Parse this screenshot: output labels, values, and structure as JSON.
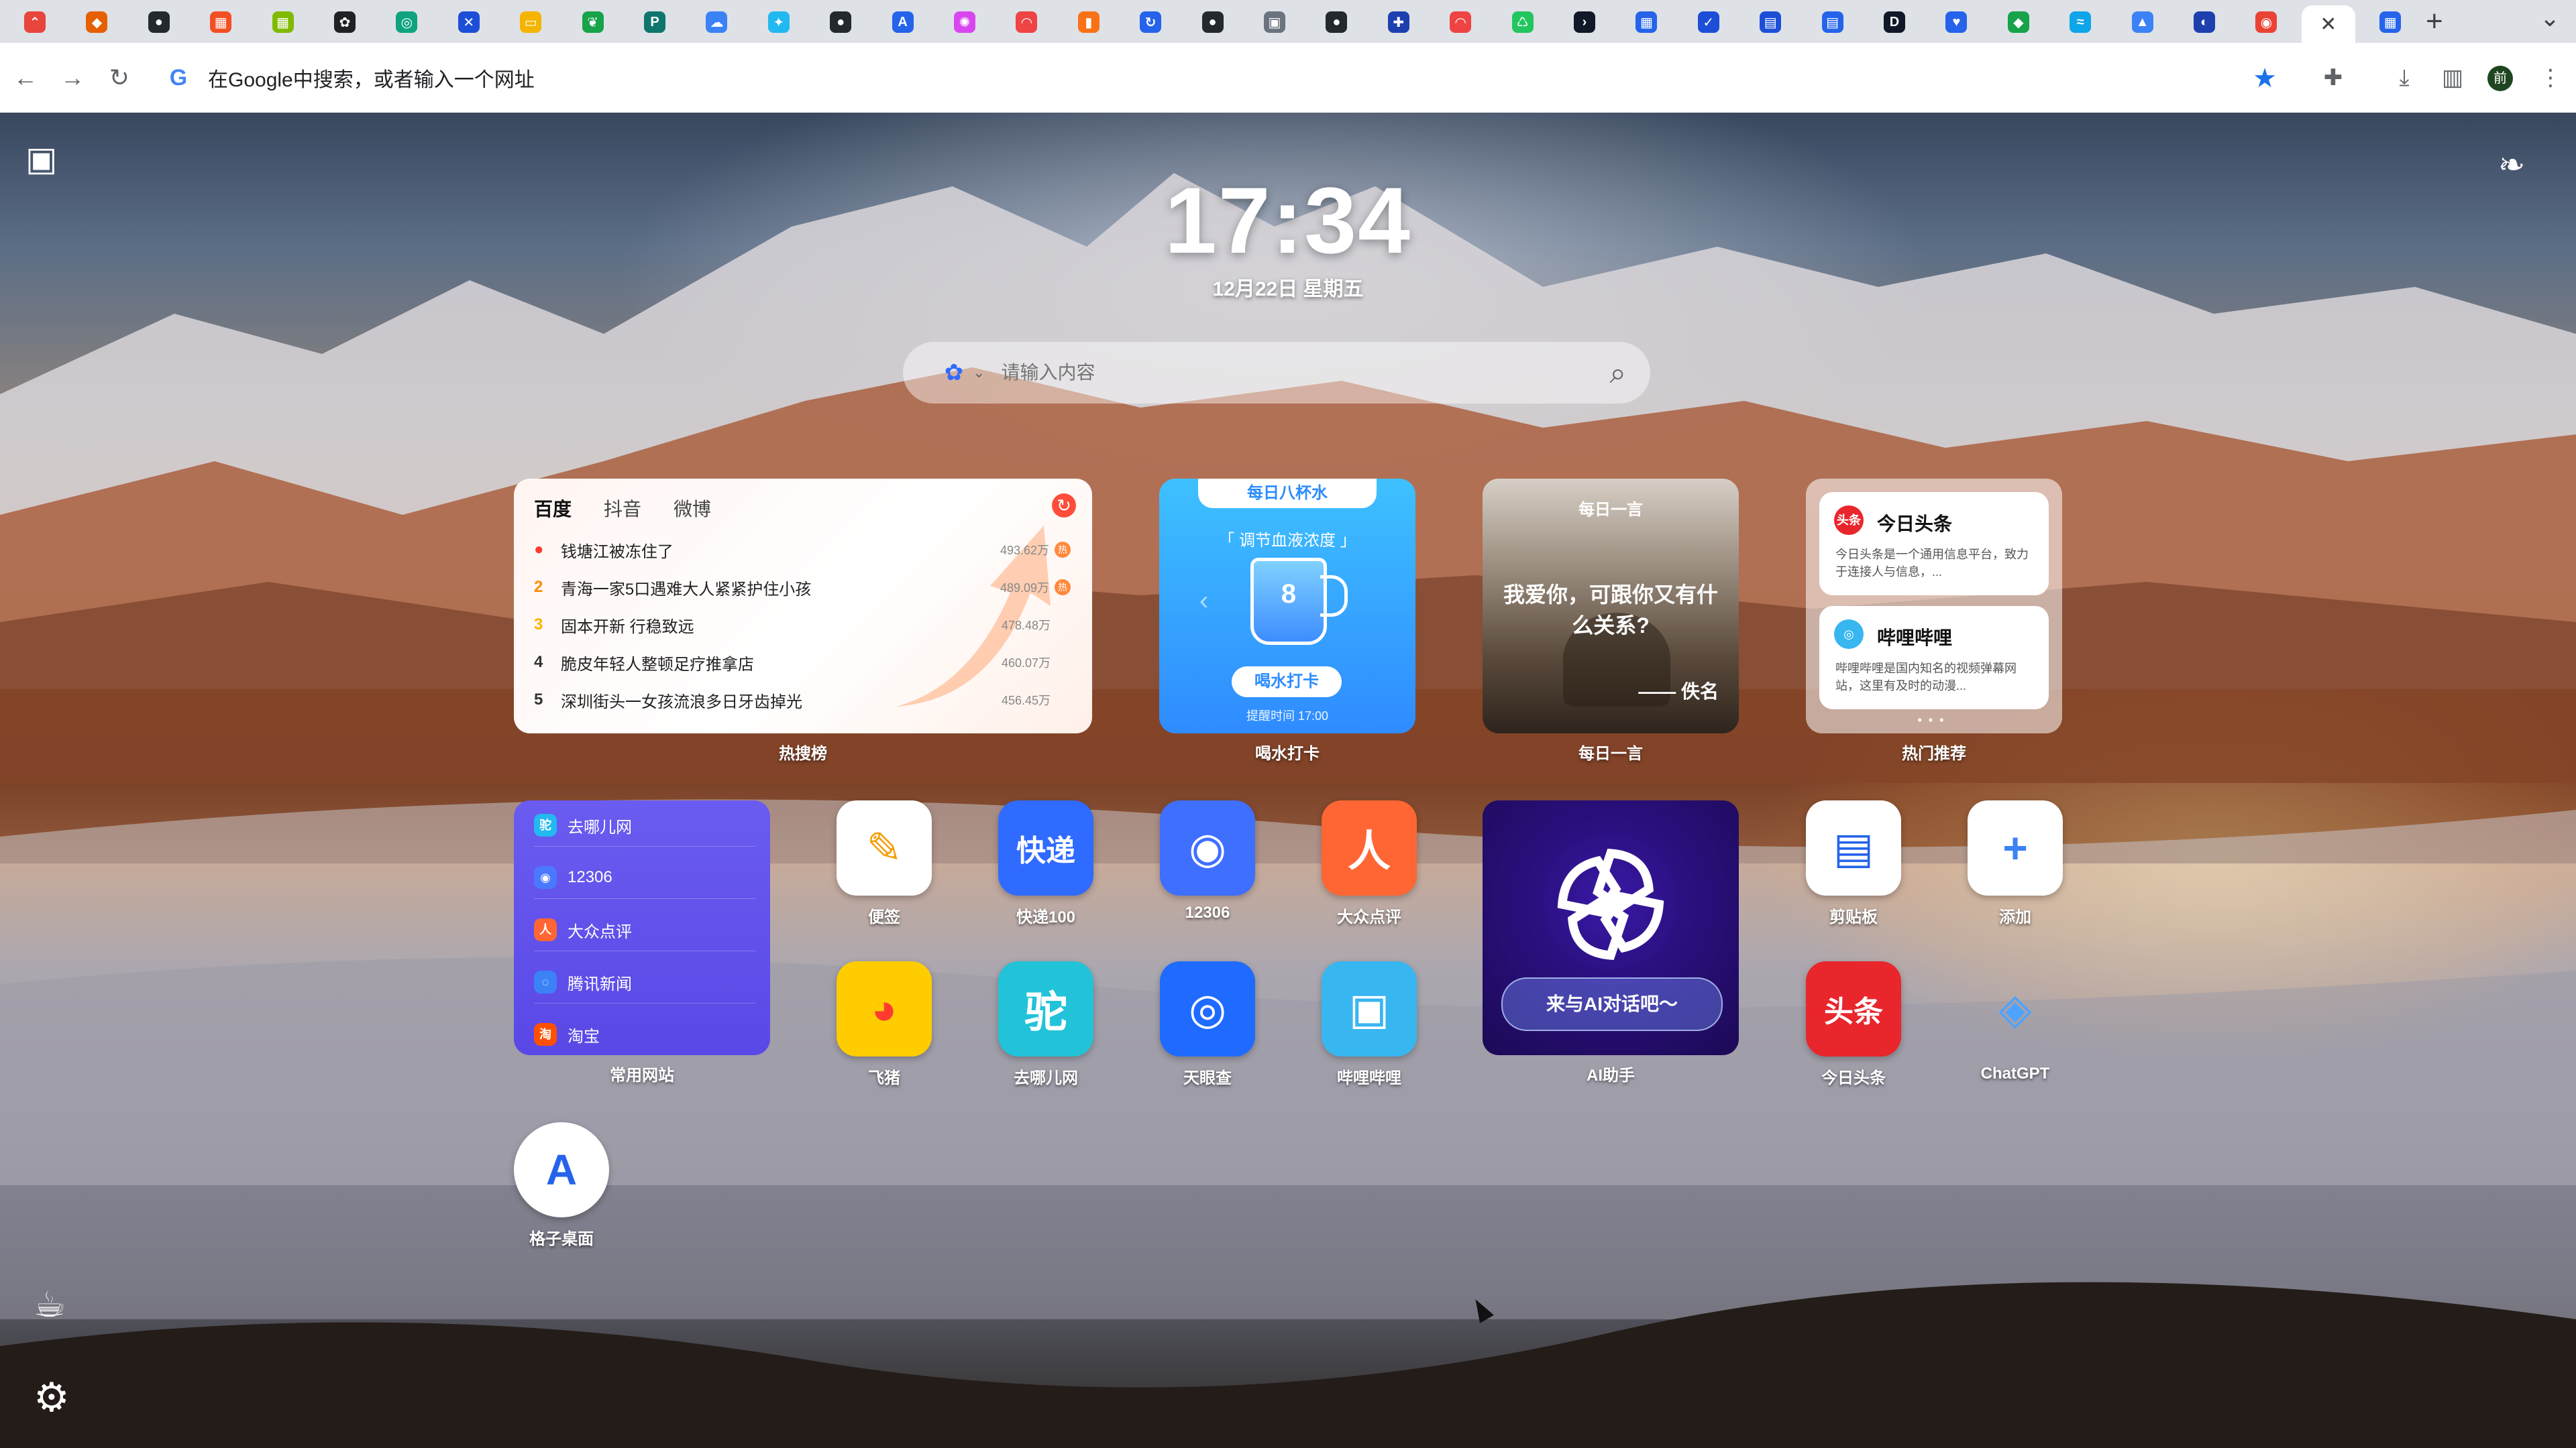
{
  "browser": {
    "tabs": [
      {
        "icon": "cursor-app-icon",
        "color": "#e8453c",
        "glyph": "⌃"
      },
      {
        "icon": "fox-icon",
        "color": "#e66000",
        "glyph": "◆"
      },
      {
        "icon": "github-icon",
        "color": "#24292e",
        "glyph": "●"
      },
      {
        "icon": "microsoft-icon",
        "color": "#f25022",
        "glyph": "▦"
      },
      {
        "icon": "microsoft-icon",
        "color": "#7fba00",
        "glyph": "▦"
      },
      {
        "icon": "openai-icon",
        "color": "#202124",
        "glyph": "✿"
      },
      {
        "icon": "chatgpt-icon",
        "color": "#10a37f",
        "glyph": "◎"
      },
      {
        "icon": "x-icon",
        "color": "#1d4ed8",
        "glyph": "✕"
      },
      {
        "icon": "folder-icon",
        "color": "#f4b400",
        "glyph": "▭"
      },
      {
        "icon": "leaf-icon",
        "color": "#16a34a",
        "glyph": "❦"
      },
      {
        "icon": "px-icon",
        "color": "#0f766e",
        "glyph": "P"
      },
      {
        "icon": "cloud-icon",
        "color": "#3b82f6",
        "glyph": "☁"
      },
      {
        "icon": "spark-icon",
        "color": "#22b8f0",
        "glyph": "✦"
      },
      {
        "icon": "github-icon",
        "color": "#24292e",
        "glyph": "●"
      },
      {
        "icon": "translate-icon",
        "color": "#2563eb",
        "glyph": "A"
      },
      {
        "icon": "colorwheel-icon",
        "color": "#d946ef",
        "glyph": "✺"
      },
      {
        "icon": "rainbow-icon",
        "color": "#ef4444",
        "glyph": "◠"
      },
      {
        "icon": "chart-icon",
        "color": "#f97316",
        "glyph": "▮"
      },
      {
        "icon": "refresh-icon",
        "color": "#2563eb",
        "glyph": "↻"
      },
      {
        "icon": "github-icon",
        "color": "#24292e",
        "glyph": "●"
      },
      {
        "icon": "image-icon",
        "color": "#6b7280",
        "glyph": "▣"
      },
      {
        "icon": "github-icon",
        "color": "#24292e",
        "glyph": "●"
      },
      {
        "icon": "puzzle-icon",
        "color": "#1e40af",
        "glyph": "✚"
      },
      {
        "icon": "rainbow-icon",
        "color": "#ef4444",
        "glyph": "◠"
      },
      {
        "icon": "recycle-icon",
        "color": "#22c55e",
        "glyph": "♺"
      },
      {
        "icon": "terminal-icon",
        "color": "#111827",
        "glyph": "›"
      },
      {
        "icon": "grid-icon",
        "color": "#2563eb",
        "glyph": "▦"
      },
      {
        "icon": "check-icon",
        "color": "#1d4ed8",
        "glyph": "✓"
      },
      {
        "icon": "doc-icon",
        "color": "#1d4ed8",
        "glyph": "▤"
      },
      {
        "icon": "doc-icon",
        "color": "#2563eb",
        "glyph": "▤"
      },
      {
        "icon": "bookmark-icon",
        "color": "#111827",
        "glyph": "D"
      },
      {
        "icon": "heart-icon",
        "color": "#2563eb",
        "glyph": "♥"
      },
      {
        "icon": "chat-icon",
        "color": "#16a34a",
        "glyph": "◆"
      },
      {
        "icon": "wave-icon",
        "color": "#0ea5e9",
        "glyph": "≈"
      },
      {
        "icon": "triangle-icon",
        "color": "#3b82f6",
        "glyph": "▲"
      },
      {
        "icon": "globe-icon",
        "color": "#1e40af",
        "glyph": "◐"
      },
      {
        "icon": "chrome-icon",
        "color": "#ea4335",
        "glyph": "◉"
      },
      {
        "icon": "close-icon",
        "color": "#3c4043",
        "glyph": "✕",
        "active": true
      },
      {
        "icon": "grid-icon",
        "color": "#2563eb",
        "glyph": "▦"
      }
    ],
    "new_tab_label": "+",
    "omnibox_text": "在Google中搜索，或者输入一个网址",
    "profile_initial": "前"
  },
  "newtab": {
    "clock": "17:34",
    "date": "12月22日 星期五",
    "search_placeholder": "请输入内容",
    "hot": {
      "tabs": [
        "百度",
        "抖音",
        "微博"
      ],
      "items": [
        {
          "rank": "",
          "title": "钱塘江被冻住了",
          "heat": "493.62万"
        },
        {
          "rank": "2",
          "title": "青海一家5口遇难大人紧紧护住小孩",
          "heat": "489.09万"
        },
        {
          "rank": "3",
          "title": "固本开新 行稳致远",
          "heat": "478.48万"
        },
        {
          "rank": "4",
          "title": "脆皮年轻人整顿足疗推拿店",
          "heat": "460.07万"
        },
        {
          "rank": "5",
          "title": "深圳街头一女孩流浪多日牙齿掉光",
          "heat": "456.45万"
        }
      ],
      "label": "热搜榜"
    },
    "water": {
      "cap": "每日八杯水",
      "subtitle": "「 调节血液浓度 」",
      "count": "8",
      "button": "喝水打卡",
      "remind": "提醒时间 17:00",
      "label": "喝水打卡"
    },
    "quote": {
      "header": "每日一言",
      "text": "我爱你，可跟你又有什么关系?",
      "author": "—— 佚名",
      "label": "每日一言"
    },
    "reco": {
      "cards": [
        {
          "logo": "头条",
          "title": "今日头条",
          "desc": "今日头条是一个通用信息平台，致力于连接人与信息，..."
        },
        {
          "logo": "◎",
          "title": "哔哩哔哩",
          "desc": "哔哩哔哩是国内知名的视频弹幕网站，这里有及时的动漫..."
        }
      ],
      "dots": "•••",
      "label": "热门推荐"
    },
    "sites": {
      "items": [
        {
          "name": "去哪儿网",
          "color": "#22b8f0",
          "glyph": "驼"
        },
        {
          "name": "12306",
          "color": "#4a78ff",
          "glyph": "◉"
        },
        {
          "name": "大众点评",
          "color": "#ff6633",
          "glyph": "人"
        },
        {
          "name": "腾讯新闻",
          "color": "#3b82f6",
          "glyph": "◌"
        },
        {
          "name": "淘宝",
          "color": "#ff5000",
          "glyph": "淘"
        }
      ],
      "label": "常用网站"
    },
    "apps": [
      {
        "name": "便签",
        "glyph": "✎",
        "bg": "#ffffff",
        "fg": "#f59e0b"
      },
      {
        "name": "快递100",
        "glyph": "快递",
        "bg": "#2f6bff",
        "fg": "#ffffff"
      },
      {
        "name": "12306",
        "glyph": "◉",
        "bg": "#3f6fff",
        "fg": "#ffffff"
      },
      {
        "name": "大众点评",
        "glyph": "人",
        "bg": "#ff6633",
        "fg": "#ffffff"
      },
      {
        "name": "剪贴板",
        "glyph": "▤",
        "bg": "#ffffff",
        "fg": "#2563eb"
      },
      {
        "name": "添加",
        "glyph": "+",
        "bg": "#ffffff",
        "fg": "#3b82f6"
      },
      {
        "name": "飞猪",
        "glyph": "◕",
        "bg": "#ffcc00",
        "fg": "#ff3b30"
      },
      {
        "name": "去哪儿网",
        "glyph": "驼",
        "bg": "#22c3d8",
        "fg": "#ffffff"
      },
      {
        "name": "天眼查",
        "glyph": "◎",
        "bg": "#1f6bff",
        "fg": "#ffffff"
      },
      {
        "name": "哔哩哔哩",
        "glyph": "▣",
        "bg": "#38b6f0",
        "fg": "#ffffff"
      },
      {
        "name": "今日头条",
        "glyph": "头条",
        "bg": "#e8262c",
        "fg": "#ffffff"
      },
      {
        "name": "ChatGPT",
        "glyph": "◈",
        "bg": "rgba(255,255,255,0)",
        "fg": "#4da3ff"
      },
      {
        "name": "格子桌面",
        "glyph": "A",
        "bg": "#ffffff",
        "fg": "#2563eb"
      }
    ],
    "ai": {
      "pill": "来与AI对话吧～",
      "label": "AI助手"
    }
  }
}
